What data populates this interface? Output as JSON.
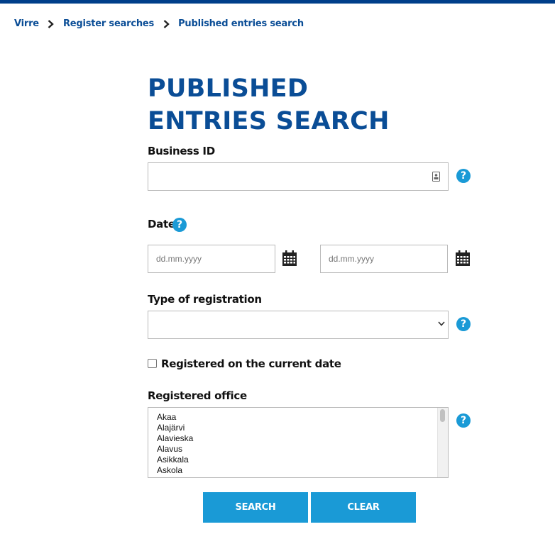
{
  "breadcrumb": {
    "items": [
      "Virre",
      "Register searches",
      "Published entries search"
    ]
  },
  "page": {
    "title": "PUBLISHED ENTRIES SEARCH"
  },
  "form": {
    "business_id": {
      "label": "Business ID",
      "value": ""
    },
    "date": {
      "label": "Date",
      "from_placeholder": "dd.mm.yyyy",
      "to_placeholder": "dd.mm.yyyy"
    },
    "registration_type": {
      "label": "Type of registration",
      "value": ""
    },
    "current_date": {
      "label": "Registered on the current date",
      "checked": false
    },
    "registered_office": {
      "label": "Registered office",
      "options": [
        "Akaa",
        "Alajärvi",
        "Alavieska",
        "Alavus",
        "Asikkala",
        "Askola"
      ]
    }
  },
  "buttons": {
    "search": "SEARCH",
    "clear": "CLEAR"
  },
  "help_glyph": "?",
  "colors": {
    "brand": "#0a4d96",
    "accent": "#1a9ad6",
    "top_bar": "#003f8a"
  },
  "icons": [
    "chevron-right-icon",
    "contact-card-icon",
    "help-icon",
    "calendar-icon",
    "chevron-down-icon"
  ]
}
